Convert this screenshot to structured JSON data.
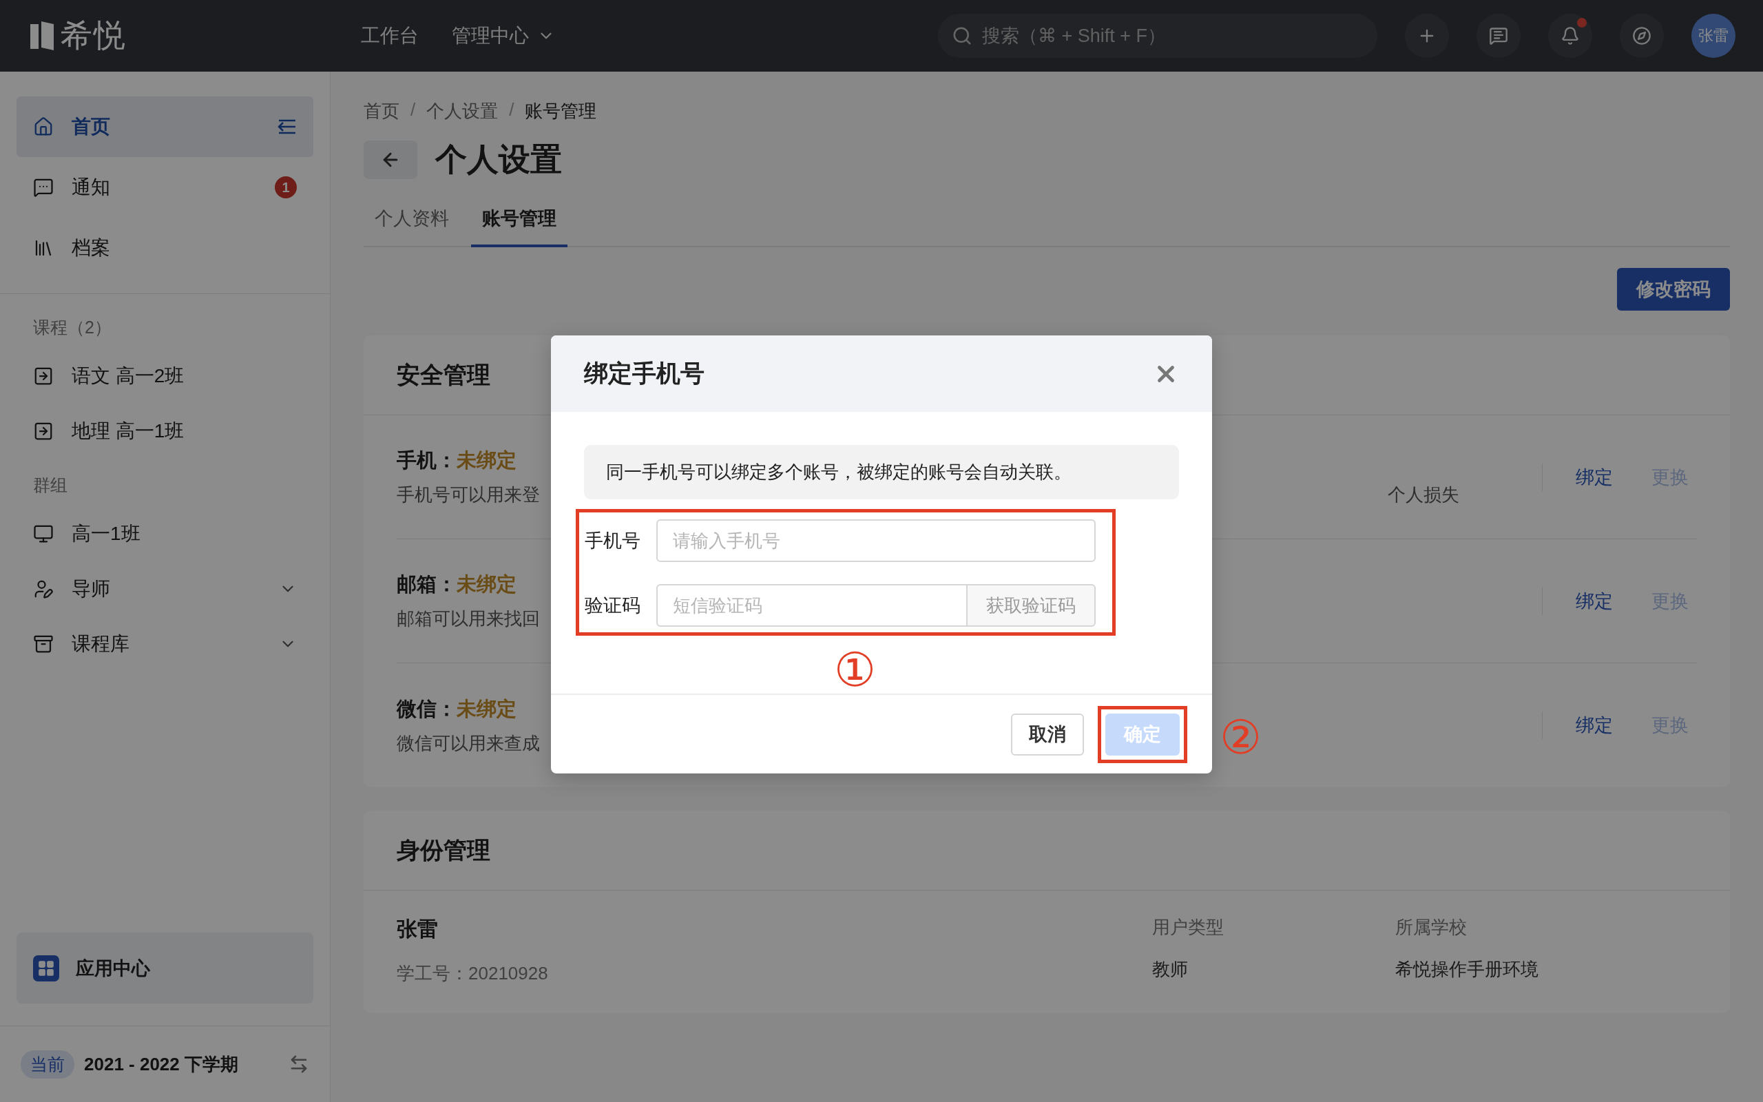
{
  "topbar": {
    "logo": "希悦",
    "nav": [
      {
        "label": "工作台",
        "dropdown": false
      },
      {
        "label": "管理中心",
        "dropdown": true
      }
    ],
    "search": {
      "placeholder": "搜索（⌘ + Shift + F）"
    },
    "notifications_dot": true,
    "avatar": "张雷"
  },
  "sidebar": {
    "items": [
      {
        "label": "首页",
        "selected": true
      },
      {
        "label": "通知",
        "selected": false,
        "badge": "1"
      },
      {
        "label": "档案",
        "selected": false
      }
    ],
    "sections": [
      {
        "title": "课程（2）",
        "items": [
          {
            "label": "语文 高一2班",
            "chevron": false
          },
          {
            "label": "地理 高一1班",
            "chevron": false
          }
        ]
      },
      {
        "title": "群组",
        "items": [
          {
            "label": "高一1班",
            "chevron": false
          },
          {
            "label": "导师",
            "chevron": true
          },
          {
            "label": "课程库",
            "chevron": true
          }
        ]
      }
    ],
    "app_center": "应用中心",
    "term": {
      "tag": "当前",
      "label": "2021 - 2022 下学期"
    }
  },
  "breadcrumb": {
    "separator": "/",
    "items": [
      "首页",
      "个人设置",
      "账号管理"
    ]
  },
  "page_title": "个人设置",
  "tabs": [
    {
      "label": "个人资料",
      "selected": false
    },
    {
      "label": "账号管理",
      "selected": true
    }
  ],
  "change_password": "修改密码",
  "security": {
    "title": "安全管理",
    "rows": [
      {
        "label": "手机：",
        "status": "未绑定",
        "description": "手机号可以用来登",
        "description_end": "个人损失",
        "bind": "绑定",
        "change": "更换"
      },
      {
        "label": "邮箱：",
        "status": "未绑定",
        "description": "邮箱可以用来找回",
        "bind": "绑定",
        "change": "更换"
      },
      {
        "label": "微信：",
        "status": "未绑定",
        "description": "微信可以用来查成",
        "bind": "绑定",
        "change": "更换"
      }
    ]
  },
  "identity": {
    "title": "身份管理",
    "name": "张雷",
    "id_label": "学工号：20210928",
    "fields": [
      {
        "label": "用户类型",
        "value": "教师"
      },
      {
        "label": "所属学校",
        "value": "希悦操作手册环境"
      }
    ]
  },
  "dialog": {
    "title": "绑定手机号",
    "notice": "同一手机号可以绑定多个账号，被绑定的账号会自动关联。",
    "phone_label": "手机号",
    "phone_placeholder": "请输入手机号",
    "code_label": "验证码",
    "code_placeholder": "短信验证码",
    "get_code": "获取验证码",
    "cancel": "取消",
    "confirm": "确定",
    "confirm_disabled": true
  },
  "annotations": [
    "①",
    "②"
  ]
}
